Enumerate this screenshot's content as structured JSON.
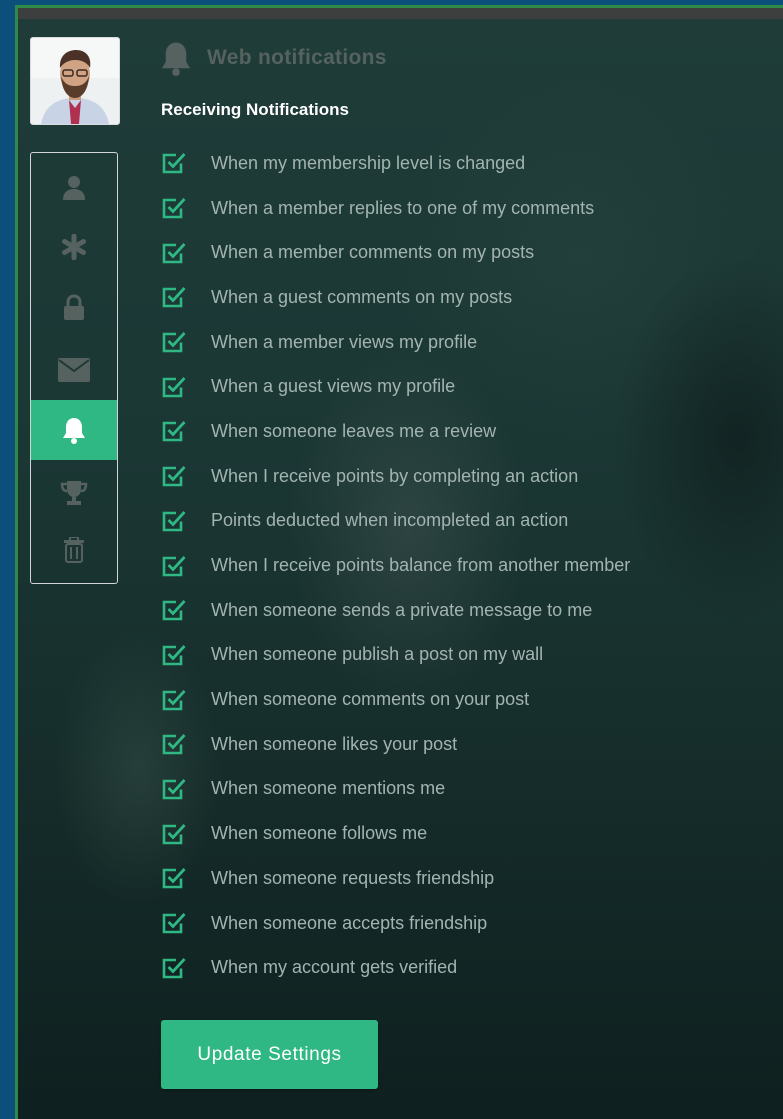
{
  "header": {
    "title": "Web notifications",
    "icon": "bell-icon"
  },
  "section": {
    "title": "Receiving Notifications"
  },
  "sidebar": {
    "items": [
      {
        "icon": "user-icon",
        "active": false
      },
      {
        "icon": "asterisk-icon",
        "active": false
      },
      {
        "icon": "lock-icon",
        "active": false
      },
      {
        "icon": "envelope-icon",
        "active": false
      },
      {
        "icon": "bell-icon",
        "active": true
      },
      {
        "icon": "trophy-icon",
        "active": false
      },
      {
        "icon": "trash-icon",
        "active": false
      }
    ]
  },
  "notifications": [
    {
      "label": "When my membership level is changed",
      "checked": true
    },
    {
      "label": "When a member replies to one of my comments",
      "checked": true
    },
    {
      "label": "When a member comments on my posts",
      "checked": true
    },
    {
      "label": "When a guest comments on my posts",
      "checked": true
    },
    {
      "label": "When a member views my profile",
      "checked": true
    },
    {
      "label": "When a guest views my profile",
      "checked": true
    },
    {
      "label": "When someone leaves me a review",
      "checked": true
    },
    {
      "label": "When I receive points by completing an action",
      "checked": true
    },
    {
      "label": "Points deducted when incompleted an action",
      "checked": true
    },
    {
      "label": "When I receive points balance from another member",
      "checked": true
    },
    {
      "label": "When someone sends a private message to me",
      "checked": true
    },
    {
      "label": "When someone publish a post on my wall",
      "checked": true
    },
    {
      "label": "When someone comments on your post",
      "checked": true
    },
    {
      "label": "When someone likes your post",
      "checked": true
    },
    {
      "label": "When someone mentions me",
      "checked": true
    },
    {
      "label": "When someone follows me",
      "checked": true
    },
    {
      "label": "When someone requests friendship",
      "checked": true
    },
    {
      "label": "When someone accepts friendship",
      "checked": true
    },
    {
      "label": "When my account gets verified",
      "checked": true
    }
  ],
  "actions": {
    "update_label": "Update Settings"
  },
  "colors": {
    "accent": "#2fb884",
    "frame": "#2e8a49",
    "page_bg": "#0b4f7a"
  }
}
